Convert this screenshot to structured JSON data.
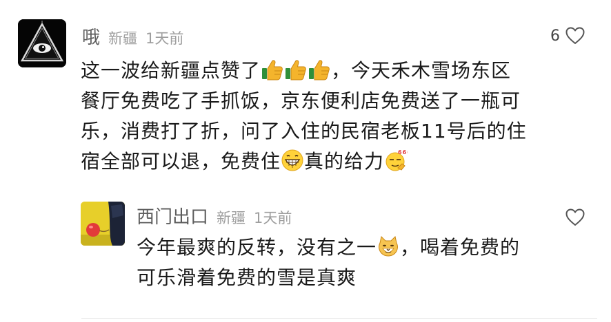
{
  "comment": {
    "username": "哦",
    "location": "新疆",
    "time": "1天前",
    "likes": "6",
    "text": {
      "l1a": "这一波给新疆点赞了",
      "l1b": "，今天禾木雪场东区",
      "l2": "餐厅免费吃了手抓饭，京东便利店免费送了一瓶可",
      "l3": "乐，消费打了折，问了入住的民宿老板11号后的住",
      "l4a": "宿全部可以退，免费住",
      "l4b": "真的给力"
    },
    "emoji": [
      "thumbs-up",
      "thumbs-up",
      "thumbs-up",
      "grin",
      "666-cool"
    ]
  },
  "reply": {
    "username": "西门出口",
    "location": "新疆",
    "time": "1天前",
    "text": {
      "l1a": "今年最爽的反转，没有之一",
      "l1b": "，喝着免费的",
      "l2": "可乐滑着免费的雪是真爽"
    },
    "emoji": [
      "cat-face"
    ]
  },
  "colors": {
    "username": "#5d5d5d",
    "meta": "#9e9e9e",
    "text": "#1a1a1a"
  }
}
